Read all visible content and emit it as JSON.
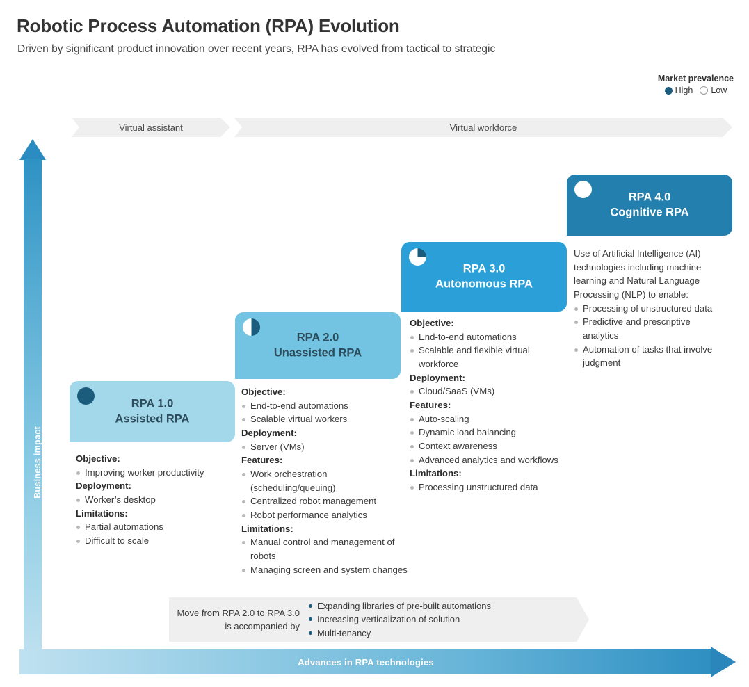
{
  "header": {
    "title": "Robotic Process Automation (RPA) Evolution",
    "subtitle": "Driven by significant product innovation over recent years, RPA has evolved from tactical to strategic"
  },
  "legend": {
    "title": "Market prevalence",
    "high_label": "High",
    "low_label": "Low",
    "high_color": "#1b5c7d",
    "low_color": "#ffffff"
  },
  "bands": [
    {
      "label": "Virtual assistant"
    },
    {
      "label": "Virtual workforce"
    }
  ],
  "axes": {
    "y_label": "Business impact",
    "x_label": "Advances in RPA technologies"
  },
  "cards": [
    {
      "version": "RPA 1.0",
      "name": "Assisted RPA",
      "marker": "full-circle-icon",
      "head_color": "#a2d8ea",
      "title_color": "#2d4c5c",
      "sections": [
        {
          "heading": "Objective:",
          "items": [
            "Improving worker productivity"
          ]
        },
        {
          "heading": "Deployment:",
          "items": [
            "Worker’s desktop"
          ]
        },
        {
          "heading": "Limitations:",
          "items": [
            "Partial automations",
            "Difficult to scale"
          ]
        }
      ]
    },
    {
      "version": "RPA 2.0",
      "name": "Unassisted RPA",
      "marker": "half-circle-icon",
      "head_color": "#72c4e2",
      "title_color": "#2d4c5c",
      "sections": [
        {
          "heading": "Objective:",
          "items": [
            "End-to-end automations",
            "Scalable virtual workers"
          ]
        },
        {
          "heading": "Deployment:",
          "items": [
            "Server (VMs)"
          ]
        },
        {
          "heading": "Features:",
          "items": [
            "Work orchestration (scheduling/queuing)",
            "Centralized robot management",
            "Robot performance analytics"
          ]
        },
        {
          "heading": "Limitations:",
          "items": [
            "Manual control and management of robots",
            "Managing screen and system changes"
          ]
        }
      ]
    },
    {
      "version": "RPA 3.0",
      "name": "Autonomous RPA",
      "marker": "quarter-circle-icon",
      "head_color": "#2ba0d8",
      "title_color": "#ffffff",
      "sections": [
        {
          "heading": "Objective:",
          "items": [
            "End-to-end automations",
            "Scalable and flexible virtual workforce"
          ]
        },
        {
          "heading": "Deployment:",
          "items": [
            "Cloud/SaaS (VMs)"
          ]
        },
        {
          "heading": "Features:",
          "items": [
            "Auto-scaling",
            "Dynamic load balancing",
            "Context awareness",
            "Advanced analytics and workflows"
          ]
        },
        {
          "heading": "Limitations:",
          "items": [
            "Processing unstructured data"
          ]
        }
      ]
    },
    {
      "version": "RPA 4.0",
      "name": "Cognitive RPA",
      "marker": "empty-circle-icon",
      "head_color": "#2380ae",
      "title_color": "#ffffff",
      "intro": "Use of Artificial Intelligence (AI) technologies including machine learning and Natural Language Processing (NLP) to enable:",
      "sections": [
        {
          "heading": "",
          "items": [
            "Processing of unstructured data",
            "Predictive and prescriptive analytics",
            "Automation of tasks that involve judgment"
          ]
        }
      ]
    }
  ],
  "callout": {
    "lead": "Move from RPA 2.0 to RPA 3.0 is accompanied by",
    "items": [
      "Expanding libraries of pre-built automations",
      "Increasing verticalization of solution",
      "Multi-tenancy"
    ]
  }
}
